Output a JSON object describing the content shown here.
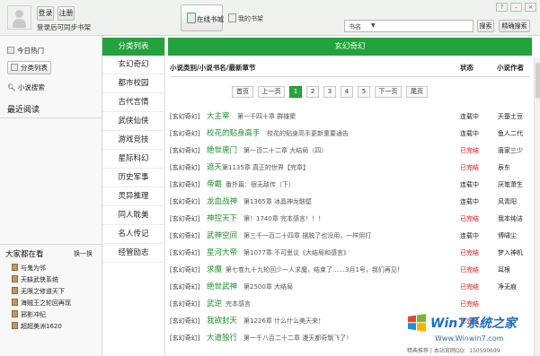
{
  "header": {
    "login_label": "登录",
    "register_label": "注册",
    "login_hint": "登录后可同步书架",
    "tab_online": "在线书城",
    "tab_shelf": "我的书架",
    "search_type": "书名",
    "search_label": "搜索",
    "exact_search_label": "精确搜索",
    "window_controls": [
      "?",
      "–",
      "×"
    ]
  },
  "sidebar": {
    "today_hot": "今日热门",
    "category_list": "分类列表",
    "novel_search": "小说搜索",
    "recent_reading": "最近阅读",
    "popular_title": "大家都在看",
    "refresh": "换一换",
    "popular": [
      "与鬼为邻",
      "天缺武侠系统",
      "无限之修道天下",
      "海贼王之轮回再现",
      "邪影冲纪",
      "超超美洲1620"
    ]
  },
  "categories": {
    "header": "分类列表",
    "items": [
      "玄幻奇幻",
      "都市校园",
      "古代言情",
      "武侠仙侠",
      "游戏竞技",
      "星际科幻",
      "历史军事",
      "灵异推理",
      "同人耽美",
      "名人传记",
      "经管励志"
    ]
  },
  "main": {
    "title": "玄幻奇幻",
    "col_title": "小说类别/小说书名/最新章节",
    "col_status": "状态",
    "col_author": "小说作者",
    "pager": [
      "首页",
      "上一页",
      "1",
      "2",
      "3",
      "4",
      "5",
      "下一页",
      "尾页"
    ],
    "rows": [
      {
        "cat": "[玄幻奇幻]",
        "title": "大主宰",
        "chapter": "第一千四十章 群雄聚",
        "status": "连载中",
        "author": "天蚕土豆"
      },
      {
        "cat": "[玄幻奇幻]",
        "title": "校花的贴身高手",
        "chapter": "校花的贴身高手更新重要通告",
        "status": "连载中",
        "author": "鱼人二代"
      },
      {
        "cat": "[玄幻奇幻]",
        "title": "绝世唐门",
        "chapter": "第一百二十二章 大结局（四）",
        "status": "已完结",
        "author": "唐家三少"
      },
      {
        "cat": "[玄幻奇幻]",
        "title": "遮天",
        "chapter": "第1135章 真正的世界【完章】",
        "status": "已完结",
        "author": "辰东"
      },
      {
        "cat": "[玄幻奇幻]",
        "title": "帝霸",
        "chapter": "番外篇：宿无敌传（下）",
        "status": "连载中",
        "author": "厌笔萧生"
      },
      {
        "cat": "[玄幻奇幻]",
        "title": "龙血战神",
        "chapter": "第1365章 冰晶神龙骸壁",
        "status": "连载中",
        "author": "风青阳"
      },
      {
        "cat": "[玄幻奇幻]",
        "title": "神控天下",
        "chapter": "第！1740章 完本感言！！！",
        "status": "已完结",
        "author": "我本纯洁"
      },
      {
        "cat": "[玄幻奇幻]",
        "title": "武神空间",
        "chapter": "第三千一百二十四章 摆脱了也没用，一样用打",
        "status": "连载中",
        "author": "傅啸尘"
      },
      {
        "cat": "[玄幻奇幻]",
        "title": "星河大帝",
        "chapter": "第1077章 不可思议《大结局和感言》",
        "status": "已完结",
        "author": "梦入神机"
      },
      {
        "cat": "[玄幻奇幻]",
        "title": "求魔",
        "chapter": "第七卷九十九轮回少一人求魔，结束了……3月1号，我们再见！",
        "status": "已完结",
        "author": "耳根"
      },
      {
        "cat": "[玄幻奇幻]",
        "title": "绝世武神",
        "chapter": "第2500章 大结局",
        "status": "已完结",
        "author": "净无痕"
      },
      {
        "cat": "[玄幻奇幻]",
        "title": "武逆",
        "chapter": "完本感言",
        "status": "已完结",
        "author": ""
      },
      {
        "cat": "[玄幻奇幻]",
        "title": "我欲封天",
        "chapter": "第1226章 什么什么美天来！",
        "status": "已完结",
        "author": ""
      },
      {
        "cat": "[玄幻奇幻]",
        "title": "大道独行",
        "chapter": "第一千八百二十二章 漫天都奇飘飞了！",
        "status": "",
        "author": ""
      }
    ]
  },
  "status_bar": "精典推荐  |  本站官网QQ：150590699",
  "watermark": {
    "brand": "Win7系统之家",
    "url": "Www.Winwin7.com"
  }
}
